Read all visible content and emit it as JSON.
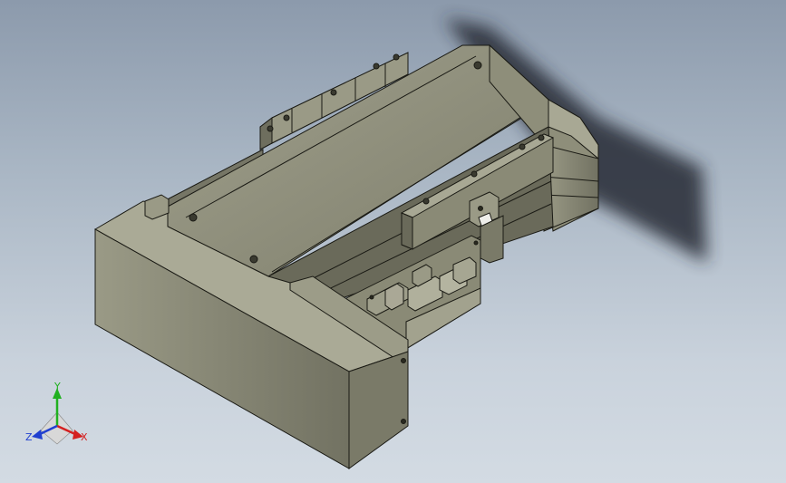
{
  "viewport": {
    "colors": {
      "background_top": "#8c9aac",
      "background_bottom": "#d3dbe3",
      "model_body": "#8a8a78",
      "model_light": "#b4b4a0",
      "model_dark": "#5e5e50",
      "edge": "#1a1a14",
      "shadow": "#2a3038"
    }
  },
  "triad": {
    "y_label": "Y",
    "x_label": "X",
    "z_label": "Z",
    "colors": {
      "x": "#d42020",
      "y": "#20b020",
      "z": "#2040d0"
    }
  }
}
